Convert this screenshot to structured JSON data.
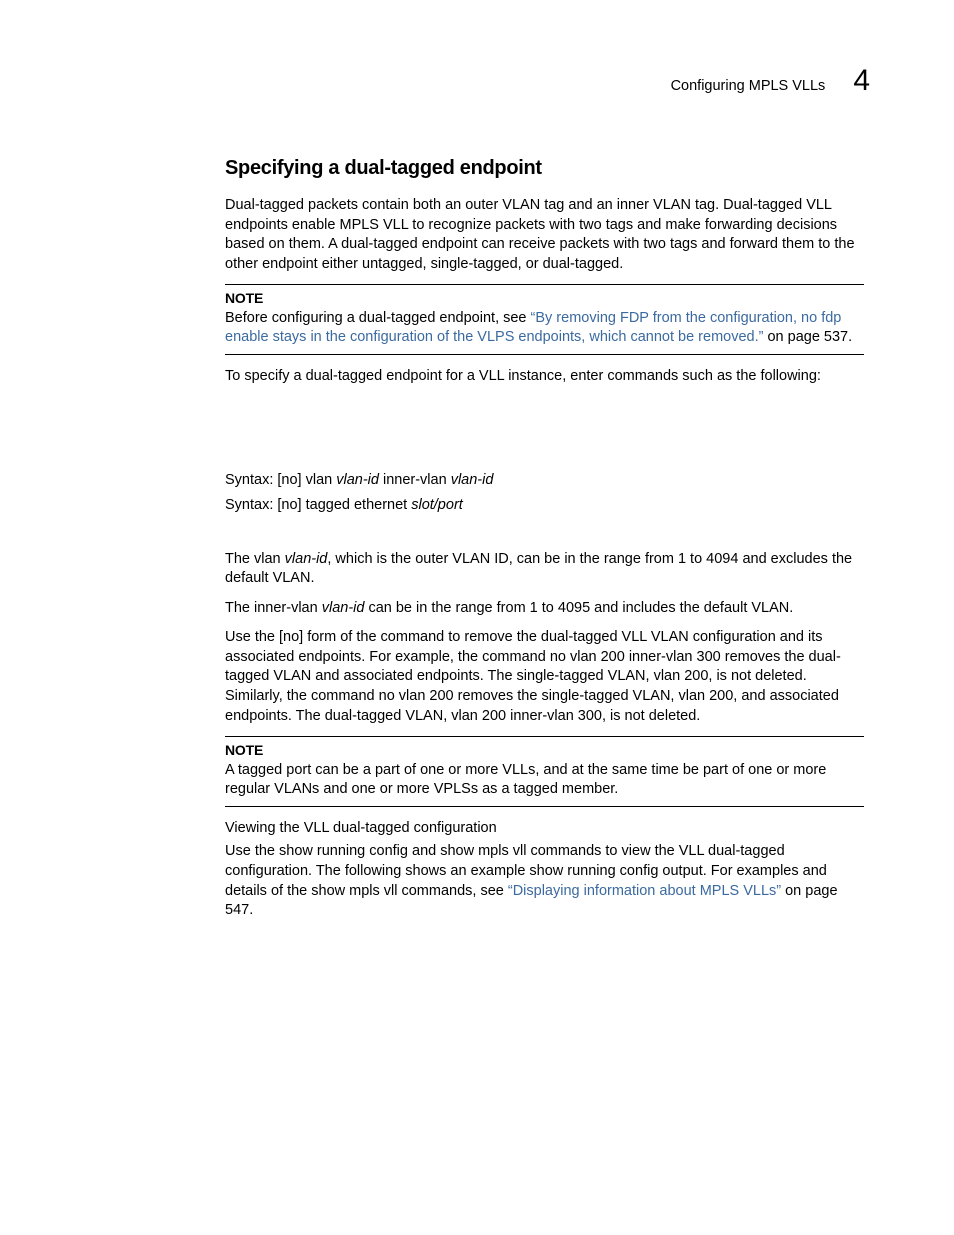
{
  "header": {
    "running_title": "Configuring MPLS VLLs",
    "chapter_number": "4"
  },
  "section": {
    "title": "Specifying a dual-tagged endpoint",
    "intro": "Dual-tagged packets contain both an outer VLAN tag and an inner VLAN tag. Dual-tagged VLL endpoints enable MPLS VLL to recognize packets with two tags and make forwarding decisions based on them. A dual-tagged endpoint can receive packets with two tags and forward them to the other endpoint either untagged, single-tagged, or dual-tagged."
  },
  "note1": {
    "label": "NOTE",
    "before": "Before configuring a dual-tagged endpoint, see ",
    "link": "“By removing FDP from the configuration, no fdp enable stays in the configuration of the VLPS endpoints, which cannot be removed.”",
    "after": " on page 537."
  },
  "para2": "To specify a dual-tagged endpoint for a VLL instance, enter commands such as the following:",
  "syntax1": {
    "prefix": "Syntax:  [no] vlan ",
    "var1": "vlan-id",
    "mid": " inner-vlan ",
    "var2": "vlan-id"
  },
  "syntax2": {
    "prefix": "Syntax:  [no] tagged ethernet ",
    "var1": "slot/port"
  },
  "para3": {
    "before": "The vlan ",
    "var": "vlan-id",
    "after": ", which is the outer VLAN ID, can be in the range from 1 to 4094 and excludes the default VLAN."
  },
  "para4": {
    "before": "The inner-vlan ",
    "var": "vlan-id",
    "after": " can be in the range from 1 to 4095 and includes the default VLAN."
  },
  "para5": "Use the [no] form of the command to remove the dual-tagged VLL VLAN configuration and its associated endpoints. For example, the command no vlan 200 inner-vlan 300 removes the dual-tagged VLAN and associated endpoints. The single-tagged VLAN, vlan 200, is not deleted. Similarly, the command no vlan 200 removes the single-tagged VLAN, vlan 200, and associated endpoints. The dual-tagged VLAN, vlan 200 inner-vlan 300, is not deleted.",
  "note2": {
    "label": "NOTE",
    "body": "A tagged port can be a part of one or more VLLs, and at the same time be part of one or more regular VLANs and one or more VPLSs as a tagged member."
  },
  "subheading": "Viewing the VLL dual-tagged configuration",
  "para6": {
    "before": "Use the show running config and show mpls vll commands to view the VLL dual-tagged configuration. The following shows an example show running config output. For examples and details of the show mpls vll commands, see ",
    "link": "“Displaying information about MPLS VLLs”",
    "after": " on page 547."
  }
}
